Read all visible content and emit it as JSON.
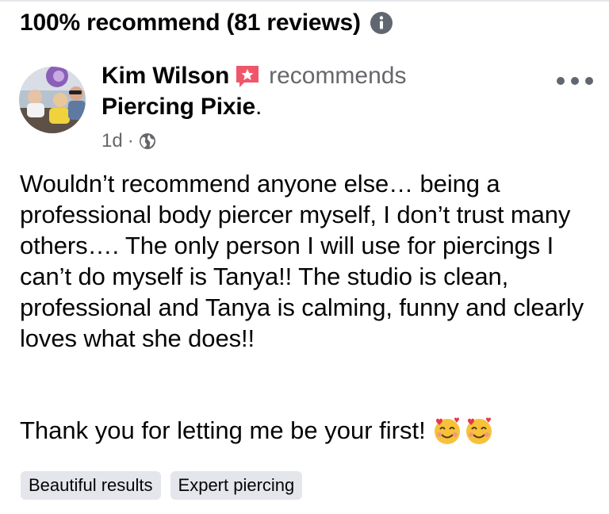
{
  "summary": {
    "title": "100% recommend (81 reviews)",
    "icon": "info-icon"
  },
  "review": {
    "author": "Kim Wilson",
    "author_badge_icon": "star-badge-icon",
    "action": "recommends",
    "page": "Piercing Pixie",
    "page_suffix": ".",
    "time": "1d",
    "separator": "·",
    "audience_icon": "globe-icon",
    "body": "Wouldn’t recommend anyone else… being a professional body piercer myself, I don’t trust many others…. The only person I will use for piercings I can’t do myself is Tanya!! The studio is clean, professional and Tanya is calming, funny and clearly loves what she does!!",
    "closing": "Thank you for letting me be your first!",
    "closing_emojis": [
      "smiling-face-with-hearts-emoji",
      "smiling-face-with-hearts-emoji"
    ],
    "tags": [
      "Beautiful results",
      "Expert piercing"
    ]
  },
  "colors": {
    "text": "#050505",
    "secondary": "#65676b",
    "badge": "#f0566a",
    "tag_bg": "#e4e6eb"
  }
}
